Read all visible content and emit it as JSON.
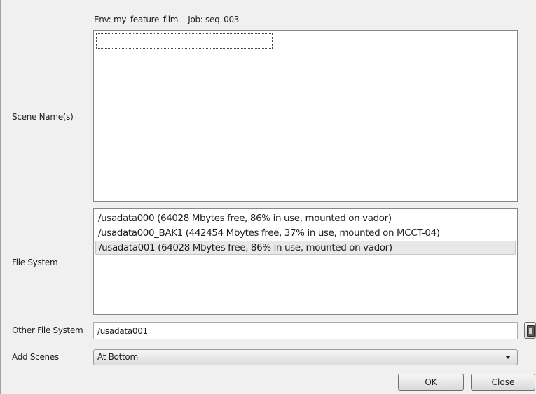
{
  "header": {
    "env_text": "Env: my_feature_film",
    "job_text": "Job: seq_003"
  },
  "labels": {
    "scene_names": "Scene Name(s)",
    "file_system": "File System",
    "other_file_system": "Other File System",
    "add_scenes": "Add Scenes"
  },
  "scene_names": {
    "edit_value": ""
  },
  "file_system": {
    "items": [
      {
        "label": "/usadata000  (64028 Mbytes free, 86% in use, mounted on vador)",
        "selected": false
      },
      {
        "label": "/usadata000_BAK1  (442454 Mbytes free, 37% in use, mounted on MCCT-04)",
        "selected": false
      },
      {
        "label": "/usadata001  (64028 Mbytes free, 86% in use, mounted on vador)",
        "selected": true
      }
    ]
  },
  "other_file_system": {
    "value": "/usadata001",
    "browse_icon": "document-icon"
  },
  "add_scenes": {
    "selected": "At Bottom",
    "arrow_icon": "chevron-down-icon"
  },
  "buttons": {
    "ok_mnemonic": "O",
    "ok_rest": "K",
    "close_mnemonic": "C",
    "close_rest": "lose"
  }
}
